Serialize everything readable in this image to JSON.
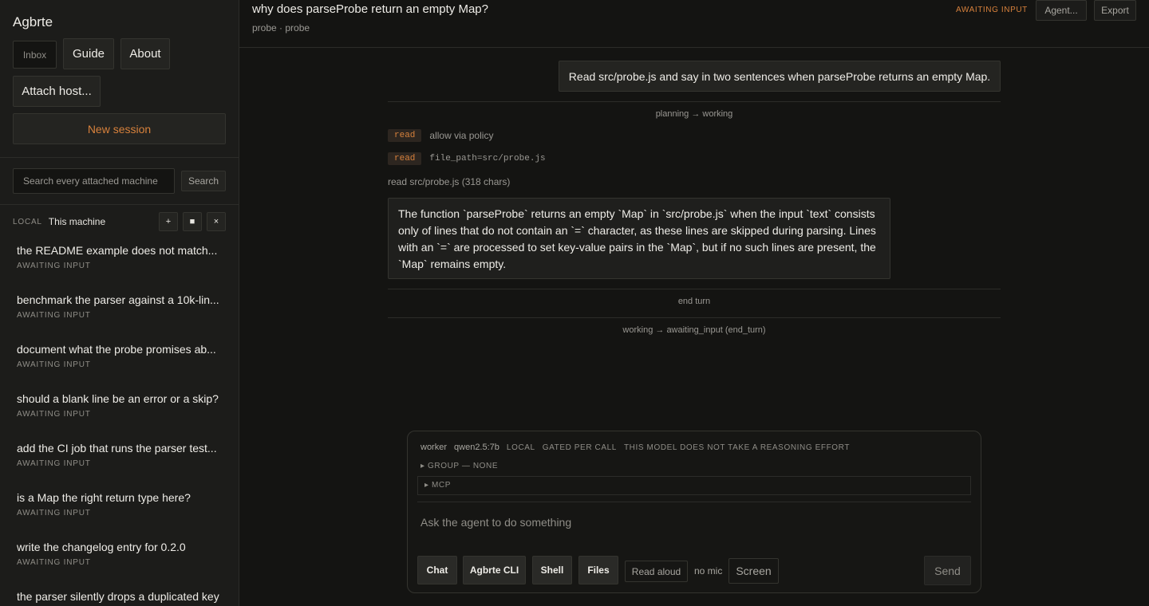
{
  "sidebar": {
    "brand": "Agbrte",
    "nav": {
      "inbox": "Inbox",
      "guide": "Guide",
      "about": "About",
      "attach_host": "Attach host..."
    },
    "new_session": "New session",
    "search": {
      "placeholder": "Search every attached machine",
      "button": "Search"
    },
    "machine": {
      "tag": "LOCAL",
      "name": "This machine",
      "add_icon": "+",
      "stop_icon": "■",
      "close_icon": "×"
    },
    "sessions": [
      {
        "title": "the README example does not match...",
        "status": "AWAITING INPUT"
      },
      {
        "title": "benchmark the parser against a 10k-lin...",
        "status": "AWAITING INPUT"
      },
      {
        "title": "document what the probe promises ab...",
        "status": "AWAITING INPUT"
      },
      {
        "title": "should a blank line be an error or a skip?",
        "status": "AWAITING INPUT"
      },
      {
        "title": "add the CI job that runs the parser test...",
        "status": "AWAITING INPUT"
      },
      {
        "title": "is a Map the right return type here?",
        "status": "AWAITING INPUT"
      },
      {
        "title": "write the changelog entry for 0.2.0",
        "status": "AWAITING INPUT"
      },
      {
        "title": "the parser silently drops a duplicated key",
        "status": ""
      }
    ]
  },
  "header": {
    "title": "why does parseProbe return an empty Map?",
    "subtitle": "probe · probe",
    "status": "AWAITING INPUT",
    "agent_button": "Agent...",
    "export_button": "Export"
  },
  "conversation": {
    "user_message": "Read src/probe.js and say in two sentences when parseProbe returns an empty Map.",
    "transition_1": "planning → working",
    "tool_1": {
      "tag": "read",
      "text": "allow via policy"
    },
    "tool_2": {
      "tag": "read",
      "text": "file_path=src/probe.js"
    },
    "read_note": "read src/probe.js (318 chars)",
    "assistant_message": "The function `parseProbe` returns an empty `Map` in `src/probe.js` when the input `text` consists only of lines that do not contain an `=` character, as these lines are skipped during parsing. Lines with an `=` are processed to set key-value pairs in the `Map`, but if no such lines are present, the `Map` remains empty.",
    "end_turn": "end turn",
    "transition_2": "working → awaiting_input (end_turn)"
  },
  "composer": {
    "worker": "worker",
    "model": "qwen2.5:7b",
    "locality": "LOCAL",
    "gating": "GATED PER CALL",
    "reasoning": "THIS MODEL DOES NOT TAKE A REASONING EFFORT",
    "group": "▸ GROUP — NONE",
    "mcp": "▸ MCP",
    "placeholder": "Ask the agent to do something",
    "modes": {
      "chat": "Chat",
      "cli": "Agbrte CLI",
      "shell": "Shell",
      "files": "Files"
    },
    "read_aloud": "Read aloud",
    "no_mic": "no mic",
    "screen": "Screen",
    "send": "Send"
  },
  "colors": {
    "accent": "#d7813c",
    "background": "#141412",
    "panel": "#1c1c1a"
  }
}
